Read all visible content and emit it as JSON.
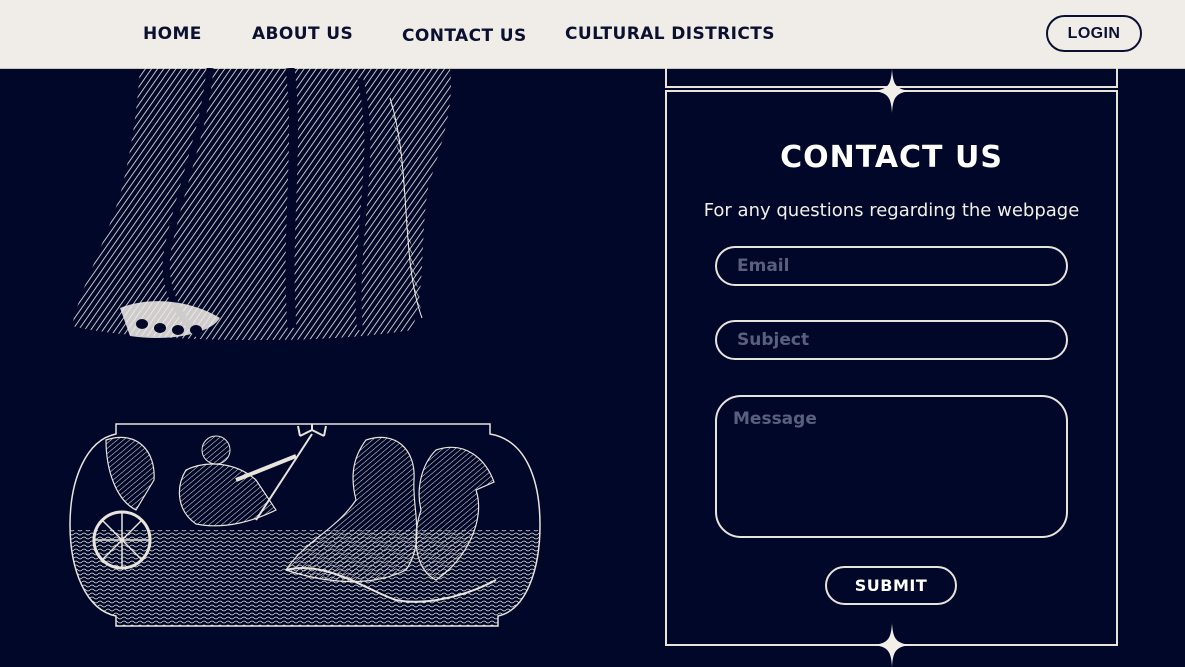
{
  "nav": {
    "links": [
      "HOME",
      "ABOUT US",
      "CONTACT US",
      "CULTURAL DISTRICTS"
    ],
    "login_label": "LOGIN"
  },
  "contact": {
    "title": "CONTACT US",
    "subtitle": "For any questions regarding the webpage",
    "email_placeholder": "Email",
    "subject_placeholder": "Subject",
    "message_placeholder": "Message",
    "submit_label": "SUBMIT"
  },
  "colors": {
    "background": "#000728",
    "nav_background": "#f0ede8",
    "nav_text": "#0b1030",
    "line": "#e8e4dc",
    "placeholder": "#59607e"
  },
  "images": {
    "statue": "engraved-statue-drapery-image",
    "chariot": "engraved-neptune-chariot-image"
  }
}
